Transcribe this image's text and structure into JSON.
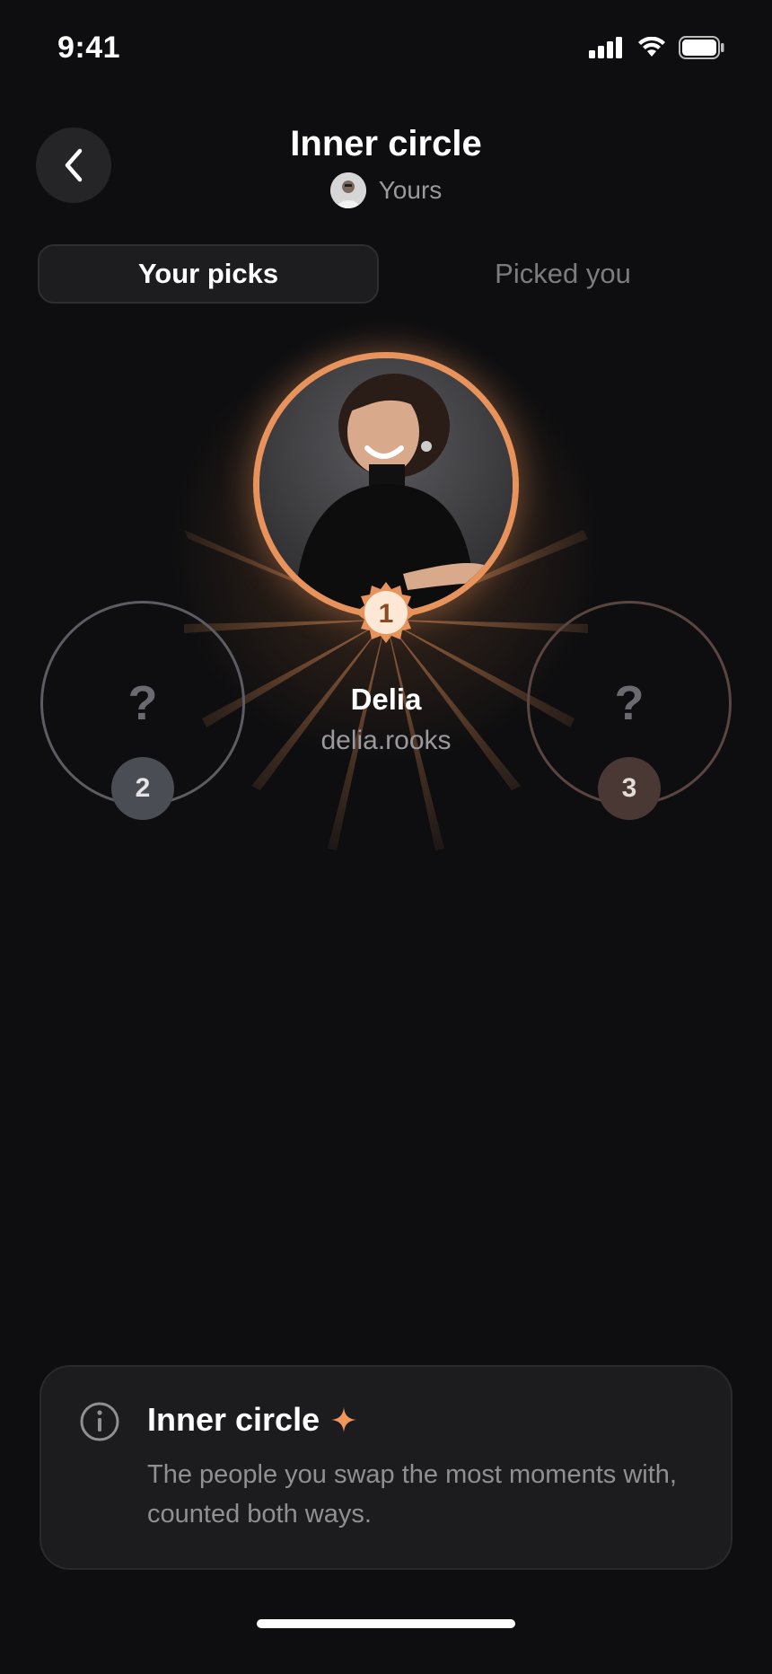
{
  "status_bar": {
    "time": "9:41"
  },
  "header": {
    "title": "Inner circle",
    "owner_label": "Yours"
  },
  "tabs": [
    {
      "label": "Your picks",
      "active": true
    },
    {
      "label": "Picked you",
      "active": false
    }
  ],
  "picks": [
    {
      "rank": "1",
      "name": "Delia",
      "handle": "delia.rooks"
    },
    {
      "rank": "2",
      "placeholder": "?"
    },
    {
      "rank": "3",
      "placeholder": "?"
    }
  ],
  "info_card": {
    "title": "Inner circle",
    "body": "The people you swap the most moments with, counted both ways."
  },
  "colors": {
    "accent": "#e8935b",
    "background": "#0e0e10",
    "card": "#1c1c1f"
  },
  "icons": [
    "back-chevron-icon",
    "signal-icon",
    "wifi-icon",
    "battery-icon",
    "info-icon",
    "sparkle-icon"
  ]
}
